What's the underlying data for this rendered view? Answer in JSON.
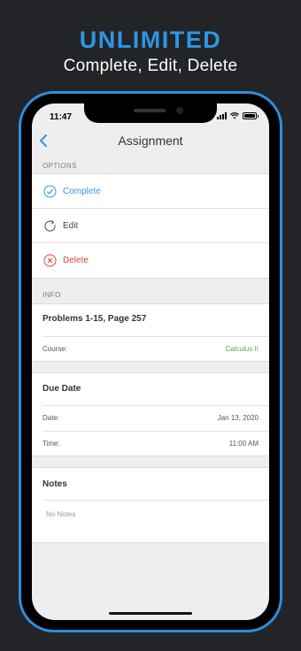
{
  "promo": {
    "title": "UNLIMITED",
    "subtitle": "Complete, Edit, Delete"
  },
  "status_bar": {
    "time": "11:47"
  },
  "navbar": {
    "title": "Assignment"
  },
  "options": {
    "header": "OPTIONS",
    "items": [
      {
        "label": "Complete",
        "icon": "check-circle-icon",
        "color": "#3a95d8"
      },
      {
        "label": "Edit",
        "icon": "refresh-icon",
        "color": "#444444"
      },
      {
        "label": "Delete",
        "icon": "x-circle-icon",
        "color": "#e2463c"
      }
    ]
  },
  "info": {
    "header": "INFO",
    "title": "Problems 1-15, Page 257",
    "course_key": "Course:",
    "course_value": "Calculus II"
  },
  "due": {
    "title": "Due Date",
    "date_key": "Date:",
    "date_value": "Jan 13, 2020",
    "time_key": "Time:",
    "time_value": "11:00 AM"
  },
  "notes": {
    "title": "Notes",
    "placeholder": "No Notes"
  },
  "colors": {
    "accent": "#2e96e6",
    "background": "#232427",
    "complete": "#3a95d8",
    "delete": "#e2463c",
    "course": "#56a85a"
  }
}
